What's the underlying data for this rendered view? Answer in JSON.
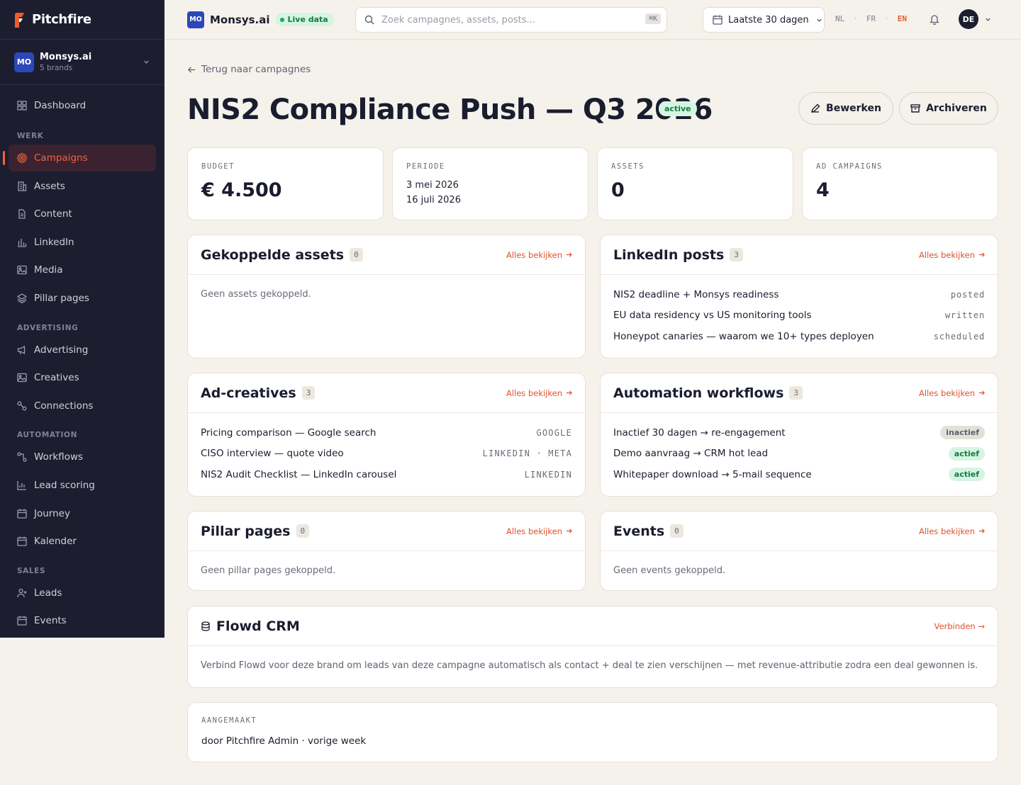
{
  "app": {
    "name": "Pitchfire"
  },
  "org": {
    "initials": "MO",
    "name": "Monsys.ai",
    "sub": "5 brands"
  },
  "nav": {
    "dashboard": "Dashboard",
    "sec_werk": "WERK",
    "campaigns": "Campaigns",
    "assets": "Assets",
    "content": "Content",
    "linkedin": "LinkedIn",
    "media": "Media",
    "pillar_pages": "Pillar pages",
    "sec_advertising": "ADVERTISING",
    "advertising": "Advertising",
    "creatives": "Creatives",
    "connections": "Connections",
    "sec_automation": "AUTOMATION",
    "workflows": "Workflows",
    "lead_scoring": "Lead scoring",
    "journey": "Journey",
    "kalender": "Kalender",
    "sec_sales": "SALES",
    "leads": "Leads",
    "events": "Events",
    "active_item": "Campaigns"
  },
  "topbar": {
    "brand_initials": "MO",
    "brand_name": "Monsys.ai",
    "live_label": "Live data",
    "search_placeholder": "Zoek campagnes, assets, posts...",
    "search_shortcut": "⌘K",
    "date_range": "Laatste 30 dagen",
    "languages": [
      "NL",
      "FR",
      "EN"
    ],
    "active_language": "EN",
    "user_initials": "DE"
  },
  "page": {
    "back_label": "Terug naar campagnes",
    "title": "NIS2 Compliance Push — Q3 2026",
    "status": "active",
    "edit_label": "Bewerken",
    "archive_label": "Archiveren"
  },
  "stats": {
    "budget": {
      "label": "BUDGET",
      "value": "€ 4.500"
    },
    "periode": {
      "label": "PERIODE",
      "start": "3 mei 2026",
      "end": "16 juli 2026"
    },
    "assets": {
      "label": "ASSETS",
      "value": "0"
    },
    "ad_campaigns": {
      "label": "AD CAMPAIGNS",
      "value": "4"
    }
  },
  "panels": {
    "see_all": "Alles bekijken",
    "assets": {
      "title": "Gekoppelde assets",
      "count": "0",
      "empty": "Geen assets gekoppeld."
    },
    "linkedin": {
      "title": "LinkedIn posts",
      "count": "3",
      "items": [
        {
          "title": "NIS2 deadline + Monsys readiness",
          "status": "posted"
        },
        {
          "title": "EU data residency vs US monitoring tools",
          "status": "written"
        },
        {
          "title": "Honeypot canaries — waarom we 10+ types deployen",
          "status": "scheduled"
        }
      ]
    },
    "creatives": {
      "title": "Ad-creatives",
      "count": "3",
      "items": [
        {
          "title": "Pricing comparison — Google search",
          "channel": "GOOGLE"
        },
        {
          "title": "CISO interview — quote video",
          "channel": "LINKEDIN · META"
        },
        {
          "title": "NIS2 Audit Checklist — LinkedIn carousel",
          "channel": "LINKEDIN"
        }
      ]
    },
    "workflows": {
      "title": "Automation workflows",
      "count": "3",
      "items": [
        {
          "title": "Inactief 30 dagen → re-engagement",
          "status": "inactief",
          "color": "#e3e0d8"
        },
        {
          "title": "Demo aanvraag → CRM hot lead",
          "status": "actief",
          "color": "#d5f5e2"
        },
        {
          "title": "Whitepaper download → 5-mail sequence",
          "status": "actief",
          "color": "#d5f5e2"
        }
      ]
    },
    "pillar": {
      "title": "Pillar pages",
      "count": "0",
      "empty": "Geen pillar pages gekoppeld."
    },
    "events": {
      "title": "Events",
      "count": "0",
      "empty": "Geen events gekoppeld."
    }
  },
  "crm": {
    "title": "Flowd CRM",
    "connect": "Verbinden →",
    "text": "Verbind Flowd voor deze brand om leads van deze campagne automatisch als contact + deal te zien verschijnen — met revenue-attributie zodra een deal gewonnen is."
  },
  "created": {
    "label": "AANGEMAAKT",
    "text": "door Pitchfire Admin · vorige week"
  },
  "colors": {
    "accent": "#ef5b2c",
    "sidebar": "#1c1e30",
    "background": "#f5f2ec",
    "brand": "#2d47b9"
  }
}
